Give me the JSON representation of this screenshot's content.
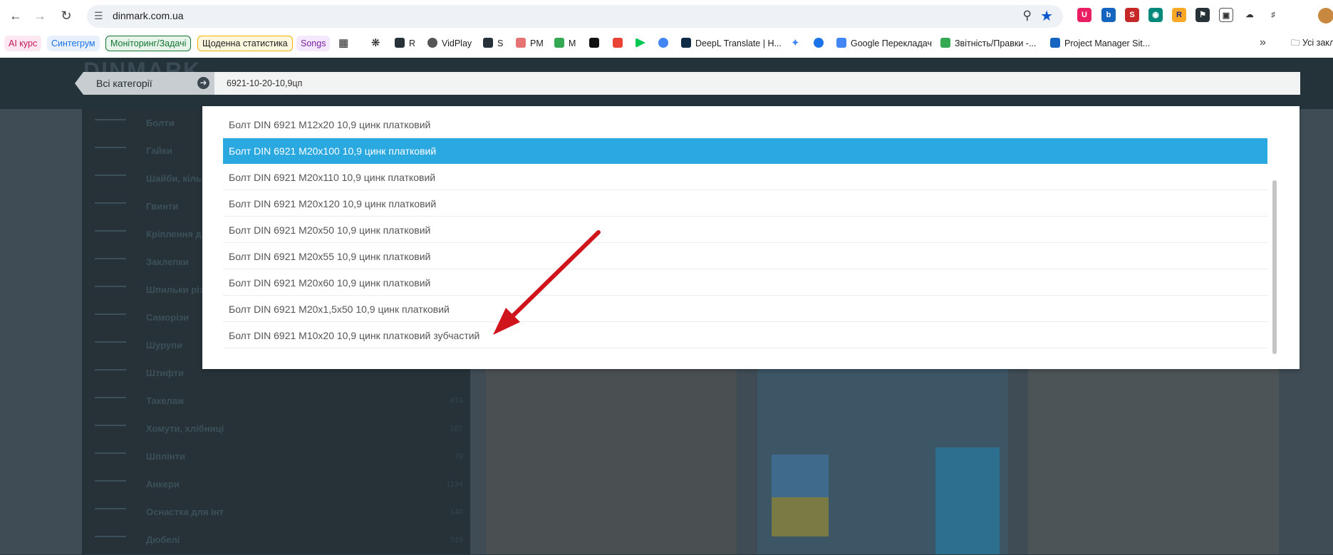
{
  "browser": {
    "url": "dinmark.com.ua",
    "bookmarks": [
      {
        "label": "AI курс",
        "color": "#c2185b",
        "bg": "#fde7f0",
        "tag": true
      },
      {
        "label": "Синтегрум",
        "color": "#1a73e8",
        "bg": "#e8f0fe",
        "tag": true
      },
      {
        "label": "Моніторинг/Задачі",
        "color": "#137333",
        "bg": "#e6f4ea",
        "tag": true
      },
      {
        "label": "Щоденна статистика",
        "color": "#1f1f1f",
        "bg": "#fef7e0",
        "tag": true
      },
      {
        "label": "Songs",
        "color": "#7b1fa2",
        "bg": "#f3e8fd",
        "tag": true
      },
      {
        "label": "",
        "color": "#333",
        "tag": false
      },
      {
        "label": "",
        "color": "#333",
        "tag": false
      },
      {
        "label": "R",
        "color": "#1f1f1f",
        "tag": false
      },
      {
        "label": "VidPlay",
        "color": "#1f1f1f",
        "tag": false
      },
      {
        "label": "S",
        "color": "#1f1f1f",
        "tag": false
      },
      {
        "label": "PM",
        "color": "#1f1f1f",
        "tag": false
      },
      {
        "label": "M",
        "color": "#1f1f1f",
        "tag": false
      },
      {
        "label": "DeepL Translate | H...",
        "color": "#1f1f1f",
        "tag": false
      },
      {
        "label": "Google Перекладач",
        "color": "#1f1f1f",
        "tag": false
      },
      {
        "label": "Звітність/Правки -...",
        "color": "#1f1f1f",
        "tag": false
      },
      {
        "label": "Project Manager Sit...",
        "color": "#1f1f1f",
        "tag": false
      }
    ],
    "bookmarks_folder": "Усі закладки"
  },
  "site": {
    "logo": "DINMARK",
    "menu": [
      {
        "label": "Болти",
        "count": ""
      },
      {
        "label": "Гайки",
        "count": ""
      },
      {
        "label": "Шайби, кільця",
        "count": ""
      },
      {
        "label": "Гвинти",
        "count": ""
      },
      {
        "label": "Кріплення д",
        "count": ""
      },
      {
        "label": "Заклепки",
        "count": ""
      },
      {
        "label": "Шпильки різ",
        "count": ""
      },
      {
        "label": "Саморізи",
        "count": ""
      },
      {
        "label": "Шурупи",
        "count": ""
      },
      {
        "label": "Штифти",
        "count": ""
      },
      {
        "label": "Такелаж",
        "count": "474"
      },
      {
        "label": "Хомути, хлібниці",
        "count": "187"
      },
      {
        "label": "Шплінти",
        "count": "79"
      },
      {
        "label": "Анкери",
        "count": "1134"
      },
      {
        "label": "Оснастка для інт",
        "count": "140"
      },
      {
        "label": "Дюбелі",
        "count": "316"
      }
    ]
  },
  "search": {
    "category_label": "Всі категорії",
    "query": "6921-10-20-10,9цп",
    "results": [
      {
        "text": "Болт DIN 6921 M12x20 10,9 цинк платковий",
        "selected": false
      },
      {
        "text": "Болт DIN 6921 M20x100 10,9 цинк платковий",
        "selected": true
      },
      {
        "text": "Болт DIN 6921 M20x110 10,9 цинк платковий",
        "selected": false
      },
      {
        "text": "Болт DIN 6921 M20x120 10,9 цинк платковий",
        "selected": false
      },
      {
        "text": "Болт DIN 6921 M20x50 10,9 цинк платковий",
        "selected": false
      },
      {
        "text": "Болт DIN 6921 M20x55 10,9 цинк платковий",
        "selected": false
      },
      {
        "text": "Болт DIN 6921 M20x60 10,9 цинк платковий",
        "selected": false
      },
      {
        "text": "Болт DIN 6921 M20x1,5x50 10,9 цинк платковий",
        "selected": false
      },
      {
        "text": "Болт DIN 6921 M10x20 10,9 цинк платковий зубчастий",
        "selected": false
      }
    ]
  },
  "colors": {
    "accent": "#2aa8e0",
    "arrow": "#d0141c",
    "clear": "#f0683c"
  }
}
